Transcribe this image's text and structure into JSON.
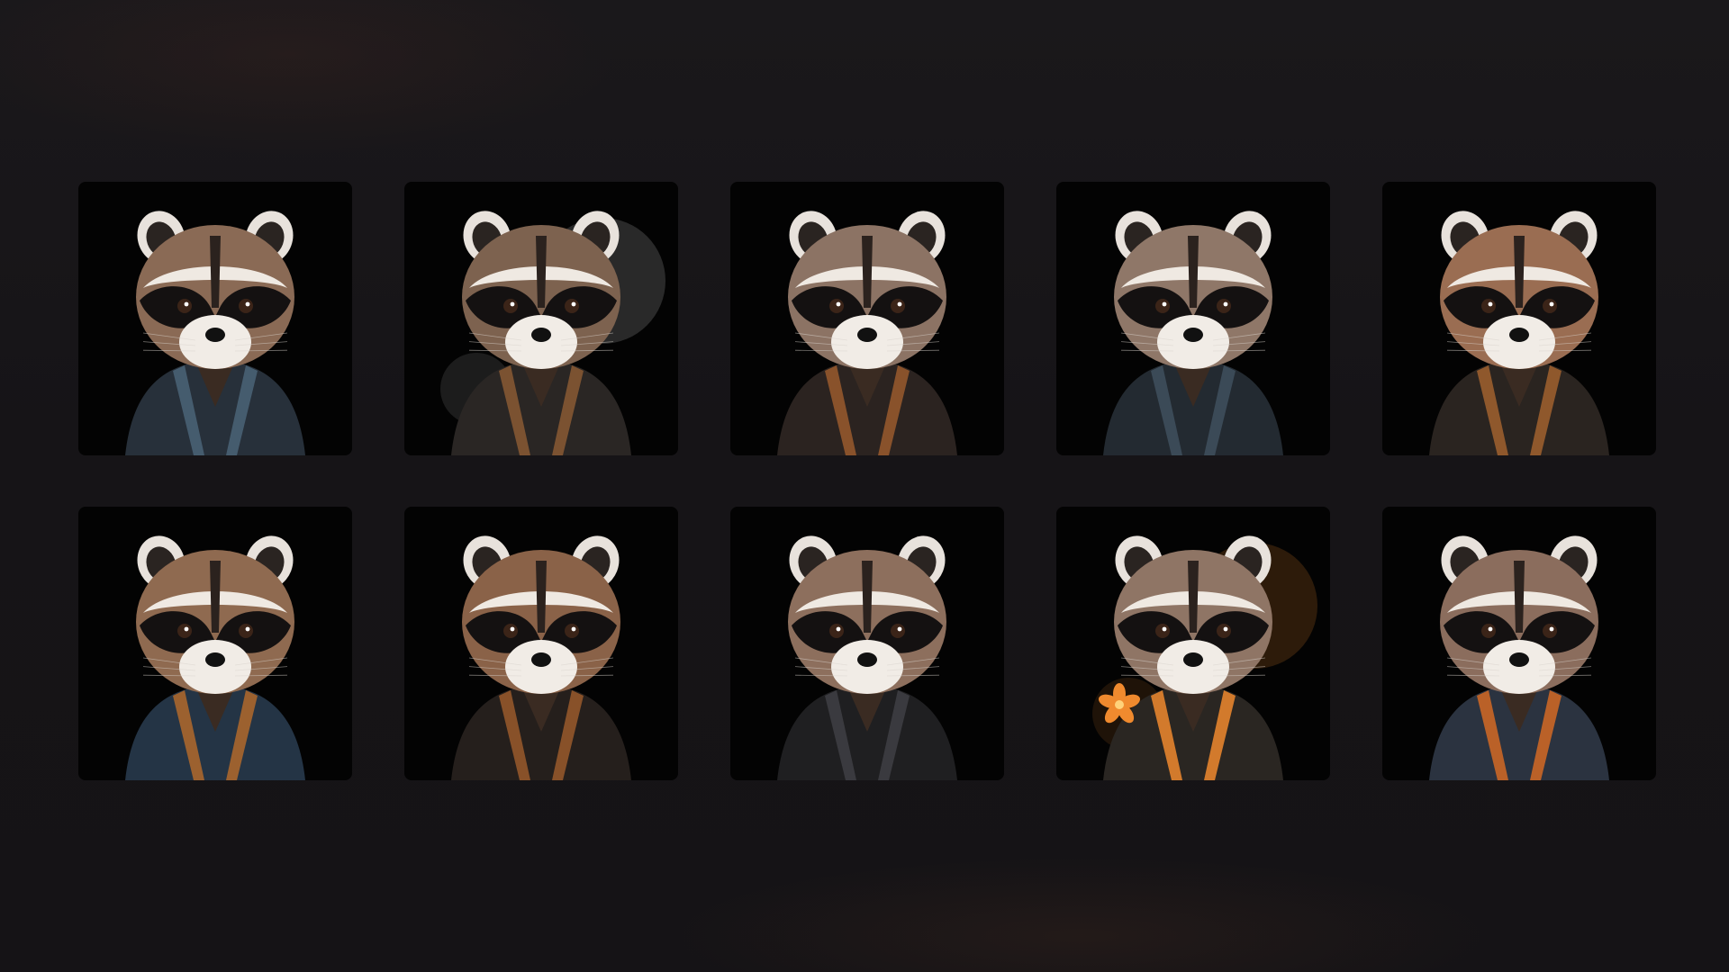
{
  "gallery": {
    "tiles": [
      {
        "icon": "raccoon-portrait-icon",
        "fur": "#8a6a55",
        "jacket": "#27303a",
        "accent": "#4b6478",
        "splash": "none"
      },
      {
        "icon": "raccoon-portrait-icon",
        "fur": "#7d624f",
        "jacket": "#2a2624",
        "accent": "#8a5a34",
        "splash": "#d9d9d9"
      },
      {
        "icon": "raccoon-portrait-icon",
        "fur": "#8c7364",
        "jacket": "#2b2320",
        "accent": "#9a5a2e",
        "splash": "none"
      },
      {
        "icon": "raccoon-portrait-icon",
        "fur": "#8f7768",
        "jacket": "#232a31",
        "accent": "#40505e",
        "splash": "none"
      },
      {
        "icon": "raccoon-portrait-icon",
        "fur": "#9a6d52",
        "jacket": "#2a2420",
        "accent": "#a1612f",
        "splash": "none"
      },
      {
        "icon": "raccoon-portrait-icon",
        "fur": "#8f6a50",
        "jacket": "#243445",
        "accent": "#b16a2c",
        "splash": "none"
      },
      {
        "icon": "raccoon-portrait-icon",
        "fur": "#8a6248",
        "jacket": "#251f1c",
        "accent": "#9a5b2c",
        "splash": "none"
      },
      {
        "icon": "raccoon-portrait-icon",
        "fur": "#8d6f5d",
        "jacket": "#1f1f21",
        "accent": "#3f3f44",
        "splash": "none"
      },
      {
        "icon": "raccoon-portrait-icon",
        "fur": "#8f7565",
        "jacket": "#2a2622",
        "accent": "#f08a2e",
        "splash": "#f08a2e"
      },
      {
        "icon": "raccoon-portrait-icon",
        "fur": "#8b6d5d",
        "jacket": "#2b3340",
        "accent": "#d36a24",
        "splash": "none"
      }
    ]
  }
}
